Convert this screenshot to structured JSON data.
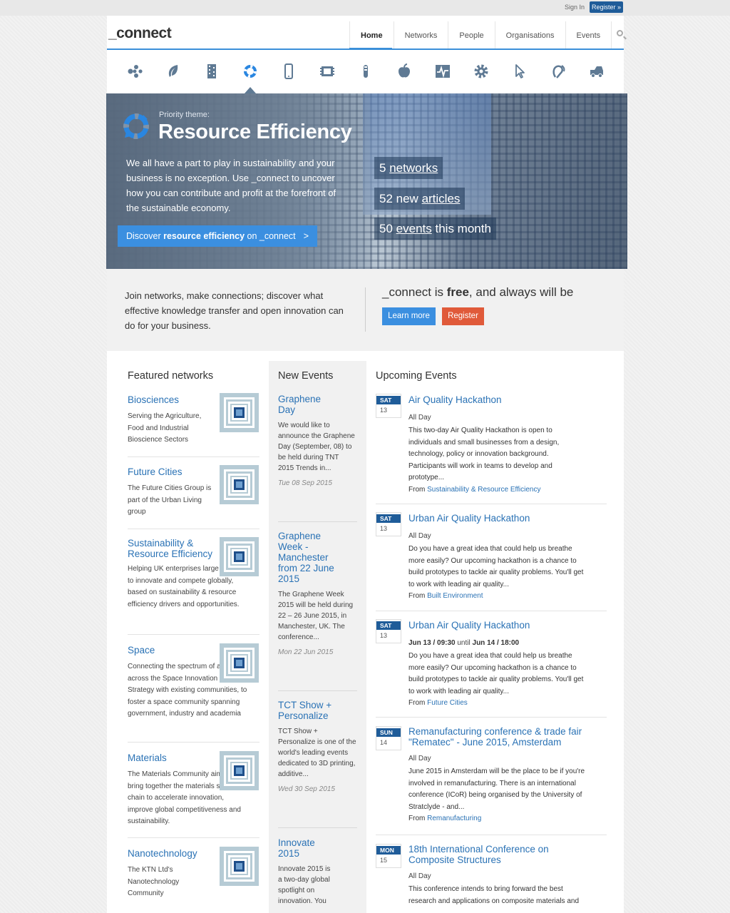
{
  "topbar": {
    "signin": "Sign In",
    "register": "Register »"
  },
  "logo": "_connect",
  "nav": {
    "items": [
      "Home",
      "Networks",
      "People",
      "Organisations",
      "Events"
    ]
  },
  "theme_icons": [
    "molecules-icon",
    "leaf-icon",
    "film-strip-icon",
    "recycle-ring-icon",
    "mobile-phone-icon",
    "chip-icon",
    "test-tube-icon",
    "apple-icon",
    "heartbeat-monitor-icon",
    "gear-icon",
    "cursor-icon",
    "hearing-icon",
    "truck-icon"
  ],
  "hero": {
    "priority_label": "Priority theme:",
    "title": "Resource Efficiency",
    "text": "We all have a part to play in sustainability and your business is no exception. Use _connect to uncover how you can contribute and profit at the forefront of the sustainable economy.",
    "button_pre": "Discover ",
    "button_bold": "resource efficiency",
    "button_post": " on _connect",
    "button_chevron": ">",
    "stat_networks_num": "5",
    "stat_networks_link": "networks",
    "stat_articles_pre": "52 new",
    "stat_articles_link": "articles",
    "stat_events_num": "50",
    "stat_events_link": "events",
    "stat_events_post": "this month"
  },
  "join": {
    "text": "Join networks, make connections; discover what effective knowledge transfer and open innovation can do for your business.",
    "free_pre": "_connect is ",
    "free_bold": "free",
    "free_post": ", and always will be",
    "learn_more": "Learn more",
    "register": "Register"
  },
  "featured": {
    "title": "Featured networks",
    "items": [
      {
        "name": "Biosciences",
        "desc": "Serving the Agriculture, Food and Industrial Bioscience Sectors"
      },
      {
        "name": "Future Cities",
        "desc": "The Future Cities Group is part of the Urban Living group"
      },
      {
        "name": "Sustainability & Resource Efficiency",
        "desc": "Helping UK enterprises large & small to innovate and compete globally, based on sustainability & resource efficiency drivers and opportunities."
      },
      {
        "name": "Space",
        "desc": "Connecting the spectrum of activities across the Space Innovation and Growth Strategy with existing communities, to foster a space community spanning government, industry and academia"
      },
      {
        "name": "Materials",
        "desc": "The Materials Community aims to bring together the materials supply chain to accelerate innovation, improve global competitiveness and sustainability."
      },
      {
        "name": "Nanotechnology",
        "desc": "The KTN Ltd's Nanotechnology Community"
      }
    ]
  },
  "new_events": {
    "title": "New Events",
    "items": [
      {
        "title": "Graphene Day",
        "desc": "We would like to announce the Graphene Day (September, 08) to be held during TNT 2015 Trends in...",
        "date": "Tue 08 Sep 2015"
      },
      {
        "title": "Graphene Week - Manchester from 22 June 2015",
        "desc": "The Graphene Week 2015 will be held during 22 – 26 June 2015, in Manchester, UK. The conference...",
        "date": "Mon 22 Jun 2015"
      },
      {
        "title": "TCT Show + Personalize",
        "desc": "TCT Show + Personalize is one of the world's leading events dedicated to 3D printing, additive...",
        "date": "Wed 30 Sep 2015"
      },
      {
        "title": "Innovate 2015",
        "desc": "Innovate 2015 is a two-day global spotlight on innovation. You",
        "date": ""
      }
    ]
  },
  "upcoming": {
    "title": "Upcoming Events",
    "from_label": "From",
    "items": [
      {
        "dow": "SAT",
        "day": "13",
        "title": "Air Quality Hackathon",
        "time": "All Day",
        "desc": "This two-day Air Quality Hackathon is open to individuals and small businesses from a design, technology, policy or innovation background. Participants will work in teams to develop and prototype...",
        "from": "Sustainability & Resource Efficiency"
      },
      {
        "dow": "SAT",
        "day": "13",
        "title": "Urban Air Quality Hackathon",
        "time": "All Day",
        "desc": "Do you have a great idea that could help us breathe more easily? Our upcoming hackathon is a chance to build prototypes to tackle air quality problems. You'll get to work with leading air quality...",
        "from": "Built Environment"
      },
      {
        "dow": "SAT",
        "day": "13",
        "title": "Urban Air Quality Hackathon",
        "time_start": "Jun 13 / 09:30",
        "time_until": "until",
        "time_end": "Jun 14 / 18:00",
        "desc": "Do you have a great idea that could help us breathe more easily? Our upcoming hackathon is a chance to build prototypes to tackle air quality problems. You'll get to work with leading air quality...",
        "from": "Future Cities"
      },
      {
        "dow": "SUN",
        "day": "14",
        "title": "Remanufacturing conference & trade fair \"Rematec\" - June 2015, Amsterdam",
        "time": "All Day",
        "desc": "June 2015 in Amsterdam will be the place to be if you're involved in remanufacturing. There is an international conference (ICoR) being organised by the University of Stratclyde - and...",
        "from": "Remanufacturing"
      },
      {
        "dow": "MON",
        "day": "15",
        "title": "18th International Conference on Composite Structures",
        "time": "All Day",
        "desc": "This conference intends to bring forward the best research and applications on composite materials and",
        "from": ""
      }
    ]
  },
  "colors": {
    "link": "#2a72b5",
    "accent": "#3b8fe0",
    "register": "#e05a3a",
    "dark_blue": "#1f5c99"
  }
}
